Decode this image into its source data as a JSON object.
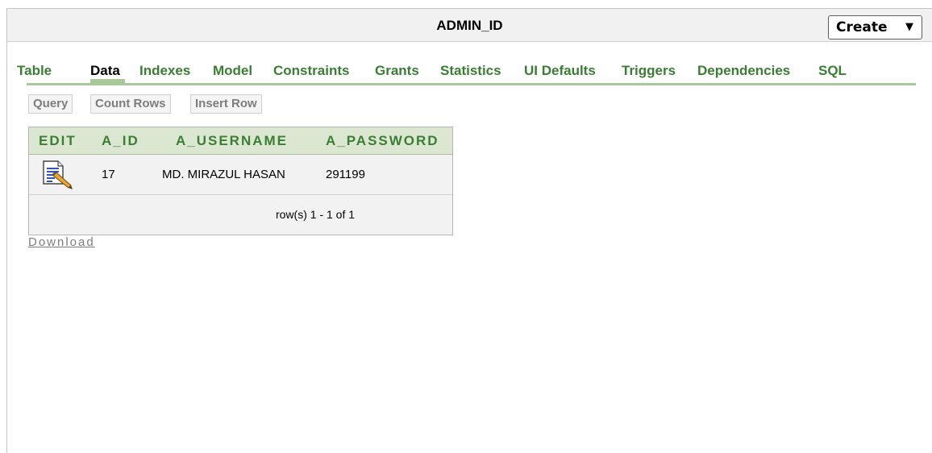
{
  "header": {
    "title": "ADMIN_ID",
    "create_label": "Create"
  },
  "tabs": [
    {
      "label": "Table"
    },
    {
      "label": "Data",
      "active": true
    },
    {
      "label": "Indexes"
    },
    {
      "label": "Model"
    },
    {
      "label": "Constraints"
    },
    {
      "label": "Grants"
    },
    {
      "label": "Statistics"
    },
    {
      "label": "UI Defaults"
    },
    {
      "label": "Triggers"
    },
    {
      "label": "Dependencies"
    },
    {
      "label": "SQL"
    }
  ],
  "toolbar": {
    "query": "Query",
    "count_rows": "Count Rows",
    "insert_row": "Insert Row"
  },
  "table": {
    "columns": [
      "EDIT",
      "A_ID",
      "A_USERNAME",
      "A_PASSWORD"
    ],
    "rows": [
      {
        "edit_icon": "edit-document-pencil-icon",
        "a_id": "17",
        "a_username": "MD. MIRAZUL HASAN",
        "a_password": "291199"
      }
    ],
    "pagination": "row(s) 1 - 1 of 1"
  },
  "download_label": "Download",
  "colors": {
    "accent_green": "#3a7e34",
    "header_bg": "#dce7d2",
    "tab_rule": "#a8c89b"
  }
}
